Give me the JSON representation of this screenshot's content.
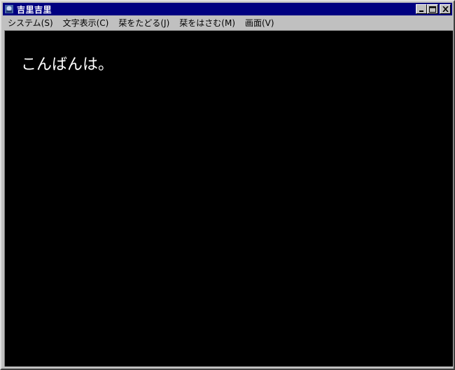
{
  "window": {
    "title": "吉里吉里"
  },
  "titlebar": {
    "minimize_icon": "minimize-icon",
    "maximize_icon": "maximize-icon",
    "close_icon": "close-icon"
  },
  "menu": {
    "items": [
      {
        "label": "システム(S)"
      },
      {
        "label": "文字表示(C)"
      },
      {
        "label": "栞をたどる(J)"
      },
      {
        "label": "栞をはさむ(M)"
      },
      {
        "label": "画面(V)"
      }
    ]
  },
  "content": {
    "text": "こんばんは。"
  },
  "colors": {
    "titlebar": "#000080",
    "chrome": "#c0c0c0",
    "canvas": "#000000",
    "text": "#ffffff"
  }
}
